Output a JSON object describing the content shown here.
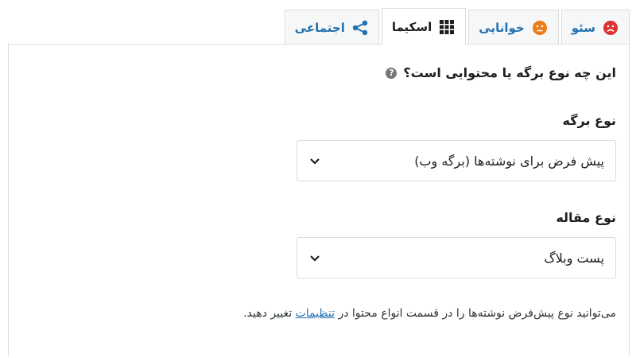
{
  "tabs": [
    {
      "label": "سئو",
      "icon": "sad-face-icon",
      "icon_color": "#dc3232",
      "active": false
    },
    {
      "label": "خوانایی",
      "icon": "neutral-face-icon",
      "icon_color": "#ee7c1b",
      "active": false
    },
    {
      "label": "اسکیما",
      "icon": "grid-icon",
      "icon_color": "#1e1e1e",
      "active": true
    },
    {
      "label": "اجتماعی",
      "icon": "share-icon",
      "icon_color": "#2271b1",
      "active": false
    }
  ],
  "schema": {
    "question": "این چه نوع برگه یا محتوایی است؟",
    "page_type_label": "نوع برگه",
    "page_type_value": "پیش فرض برای نوشته‌ها (برگه وب)",
    "article_type_label": "نوع مقاله",
    "article_type_value": "پست وبلاگ",
    "note_prefix": "می‌توانید نوع پیش‌فرض نوشته‌ها را در قسمت انواع محتوا در",
    "note_link": "تنظیمات",
    "note_suffix": "تغییر دهید."
  },
  "colors": {
    "accent": "#2271b1",
    "error": "#dc3232",
    "warning": "#ee7c1b"
  }
}
